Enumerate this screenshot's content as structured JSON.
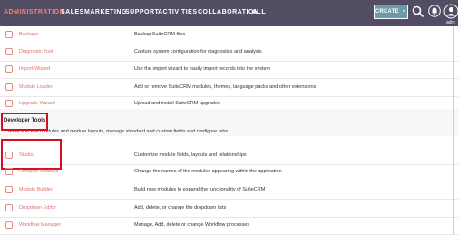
{
  "nav": {
    "items": [
      {
        "label": "ADMINISTRATION",
        "active": true
      },
      {
        "label": "SALES",
        "active": false
      },
      {
        "label": "MARKETING",
        "active": false
      },
      {
        "label": "SUPPORT",
        "active": false
      },
      {
        "label": "ACTIVITIES",
        "active": false
      },
      {
        "label": "COLLABORATION",
        "active": false
      },
      {
        "label": "ALL",
        "active": false
      }
    ],
    "create_label": "CREATE",
    "user_label": "adm"
  },
  "rows_top": [
    {
      "label": "Backups",
      "description": "Backup SuiteCRM files",
      "icon": "backup-icon"
    },
    {
      "label": "Diagnostic Tool",
      "description": "Capture system configuration for diagnostics and analysis",
      "icon": "diagnostic-icon"
    },
    {
      "label": "Import Wizard",
      "description": "Use the import wizard to easily import records into the system",
      "icon": "import-icon"
    },
    {
      "label": "Module Loader",
      "description": "Add or remove SuiteCRM modules, themes, language packs and other extensions",
      "icon": "module-loader-icon"
    },
    {
      "label": "Upgrade Wizard",
      "description": "Upload and install SuiteCRM upgrades",
      "icon": "upgrade-icon"
    }
  ],
  "section": {
    "title": "Developer Tools",
    "description": "Create and edit modules and module layouts, manage standard and custom fields and configure tabs."
  },
  "rows_bottom": [
    {
      "label": "Studio",
      "description": "Customize module fields, layouts and relationships",
      "icon": "studio-icon"
    },
    {
      "label": "Rename Modules",
      "description": "Change the names of the modules appearing within the application",
      "icon": "rename-icon"
    },
    {
      "label": "Module Builder",
      "description": "Build new modules to expand the functionality of SuiteCRM",
      "icon": "module-builder-icon"
    },
    {
      "label": "Dropdown Editor",
      "description": "Add, delete, or change the dropdown lists",
      "icon": "dropdown-icon"
    },
    {
      "label": "Workflow Manager",
      "description": "Manage, Add, delete or change Workflow processes",
      "icon": "workflow-icon"
    }
  ],
  "colors": {
    "nav_bg": "#534d64",
    "active_nav": "#f08377",
    "link": "#e2716a",
    "highlight": "#d60f20",
    "create_btn": "#6b9ba8"
  }
}
